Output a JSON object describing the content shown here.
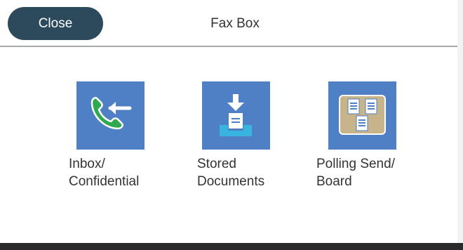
{
  "header": {
    "close_label": "Close",
    "title": "Fax Box"
  },
  "tiles": [
    {
      "id": "inbox",
      "line1": "Inbox/",
      "line2": "Confidential",
      "icon": "incoming-call-icon"
    },
    {
      "id": "stored",
      "line1": "Stored",
      "line2": "Documents",
      "icon": "document-tray-icon"
    },
    {
      "id": "polling",
      "line1": "Polling Send/",
      "line2": "Board",
      "icon": "bulletin-board-icon"
    }
  ],
  "colors": {
    "close_button": "#2d4a5c",
    "tile_background": "#4f7fc4",
    "phone_green": "#2fa84f",
    "board_tan": "#c8b48a"
  }
}
